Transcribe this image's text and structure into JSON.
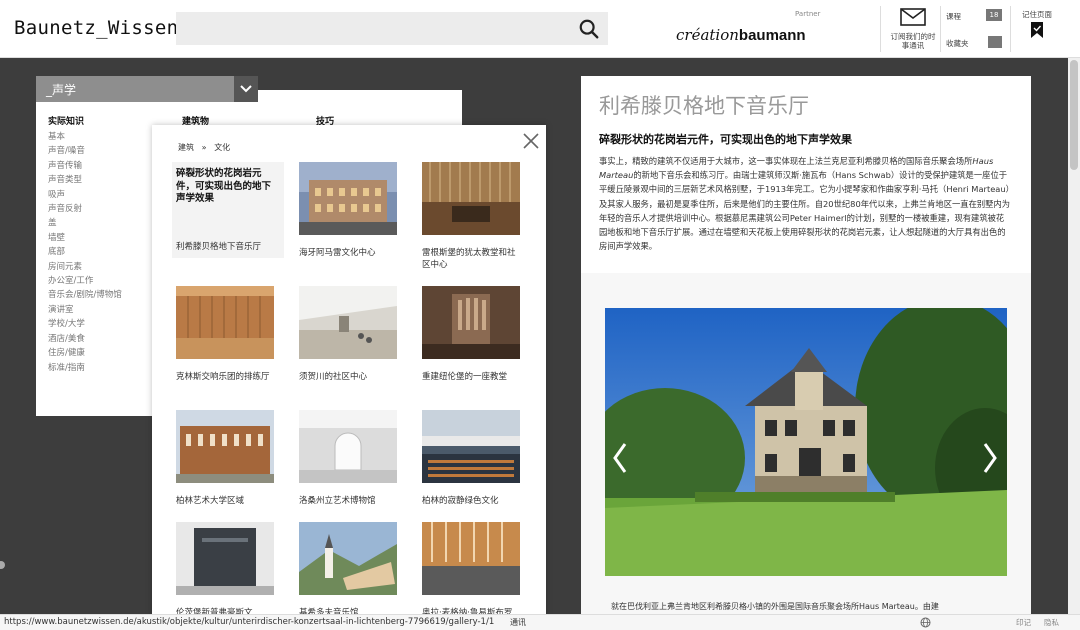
{
  "header": {
    "logo": "Baunetz_Wissen_",
    "search_placeholder": "",
    "partner_label": "Partner",
    "partner_logo_script": "création",
    "partner_logo_bold": "baumann",
    "newsletter_label": "订阅我们的时事通讯",
    "course_label": "课程",
    "course_count": "18",
    "favorites_label": "收藏夹",
    "mylist_label": "记住页面"
  },
  "topic_panel": {
    "select_value": "_声学",
    "columns": [
      "实际知识",
      "建筑物",
      "技巧"
    ],
    "items": [
      "基本",
      "声音/噪音",
      "声音传输",
      "声音类型",
      "吸声",
      "声音反射",
      "盖",
      "墙壁",
      "底部",
      "房间元素",
      "办公室/工作",
      "音乐会/剧院/博物馆",
      "演讲室",
      "学校/大学",
      "酒店/美食",
      "住房/健康",
      "标准/指南"
    ]
  },
  "gallery": {
    "breadcrumb_a": "建筑",
    "breadcrumb_sep": "»",
    "breadcrumb_b": "文化",
    "active_title": "碎裂形状的花岗岩元件，可实现出色的地下声学效果",
    "active_caption": "利希滕贝格地下音乐厅",
    "tiles": [
      {
        "caption": "海牙阿马雷文化中心"
      },
      {
        "caption": "雷根斯堡的犹太教堂和社区中心"
      },
      {
        "caption": "克林斯交响乐团的排练厅"
      },
      {
        "caption": "须贺川的社区中心"
      },
      {
        "caption": "重建纽伦堡的一座教堂"
      },
      {
        "caption": "柏林艺术大学区域"
      },
      {
        "caption": "洛桑州立艺术博物馆"
      },
      {
        "caption": "柏林的寂静绿色文化"
      },
      {
        "caption": "伦茨堡新普弗豪斯文"
      },
      {
        "caption": "基希多夫音乐馆"
      },
      {
        "caption": "奥拉·麦格纳·鲁易斯布罗"
      }
    ]
  },
  "article": {
    "title": "利希滕贝格地下音乐厅",
    "subtitle": "碎裂形状的花岗岩元件，可实现出色的地下声学效果",
    "body_1": "事实上，精致的建筑不仅适用于大城市，这一事实体现在上法兰克尼亚利希滕贝格的国际音乐聚会场所",
    "body_em": "Haus Marteau",
    "body_2": "的新地下音乐会和练习厅。由瑞士建筑师汉斯·施瓦布（Hans Schwab）设计的受保护建筑是一座位于平缓丘陵景观中间的三层新艺术风格别墅，于1913年完工。它为小提琴家和作曲家亨利·马托（Henri Marteau）及其家人服务，最初是夏季住所，后来是他们的主要住所。自20世纪80年代以来，上弗兰肯地区一直在别墅内为年轻的音乐人才提供培训中心。根据慕尼黑建筑公司Peter Haimerl的计划，别墅的一楼被重建，现有建筑被花园地板和地下音乐厅扩展。通过在墙壁和天花板上使用碎裂形状的花岗岩元素，让人想起隧道的大厅具有出色的房间声学效果。",
    "tail": "就在巴伐利亚上弗兰肯地区利希滕贝格小镇的外围是国际音乐聚会场所Haus Marteau。由建"
  },
  "statusbar": {
    "url": "https://www.baunetzwissen.de/akustik/objekte/kultur/unterirdischer-konzertsaal-in-lichtenberg-7796619/gallery-1/1",
    "extra": "通讯",
    "right_a": "印记",
    "right_b": "隐私"
  }
}
